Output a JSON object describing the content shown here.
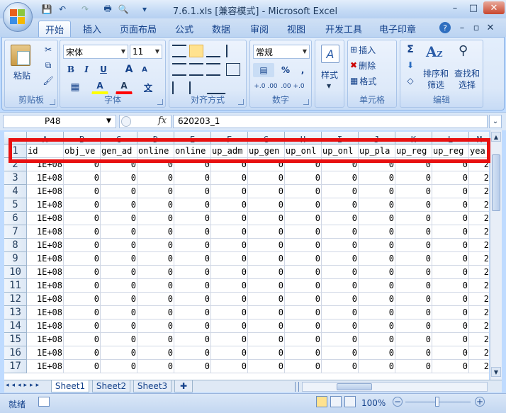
{
  "window": {
    "title": "7.6.1.xls  [兼容模式] - Microsoft Excel",
    "minimize": "–",
    "maximize": "□",
    "close": "✕"
  },
  "qat": {
    "save": "💾",
    "undo": "↶",
    "redo": "↷",
    "print": "🖶",
    "preview": "🔍",
    "more": "▾"
  },
  "ribbon_tabs": [
    "开始",
    "插入",
    "页面布局",
    "公式",
    "数据",
    "审阅",
    "视图",
    "开发工具",
    "电子印章"
  ],
  "ribbon_right": {
    "help": "?",
    "min": "–",
    "restore": "▫",
    "close": "✕"
  },
  "clipboard": {
    "label": "剪贴板",
    "paste": "粘贴",
    "cut": "✂",
    "copy": "⧉",
    "format_painter": "🖌"
  },
  "font": {
    "label": "字体",
    "name": "宋体",
    "size": "11",
    "bold": "B",
    "italic": "I",
    "underline": "U",
    "grow": "A",
    "shrink": "A",
    "border": "▦",
    "fill": "A",
    "color": "A",
    "phonetic": "文",
    "fill_color": "#ffff00",
    "font_color": "#ff0000"
  },
  "alignment": {
    "label": "对齐方式"
  },
  "number": {
    "label": "数字",
    "format": "常规",
    "percent": "%",
    "comma": ",",
    "inc": "+.0 .00",
    "dec": ".00 +.0"
  },
  "styles": {
    "label": "样式"
  },
  "cells": {
    "label": "单元格",
    "insert": "插入",
    "delete": "删除",
    "format": "格式"
  },
  "editing": {
    "label": "编辑",
    "sigma": "Σ",
    "sort": "排序和\n筛选",
    "find": "查找和\n选择",
    "sort1": "排序和",
    "sort2": "筛选",
    "find1": "查找和",
    "find2": "选择"
  },
  "namebox": "P48",
  "fx": "fx",
  "formula": "620203_1",
  "columns": [
    "A",
    "B",
    "C",
    "D",
    "E",
    "F",
    "G",
    "H",
    "I",
    "J",
    "K",
    "L",
    "M"
  ],
  "header_row": [
    "id",
    "obj_ve",
    "gen_ad",
    "online",
    "online",
    "up_adm",
    "up_gen",
    "up_onl",
    "up_onl",
    "up_pla",
    "up_reg",
    "up_reg",
    "yea"
  ],
  "row_id_value": "1E+08",
  "row_numbers": [
    "1",
    "2",
    "3",
    "4",
    "5",
    "6",
    "7",
    "8",
    "9",
    "10",
    "11",
    "12",
    "13",
    "14",
    "15",
    "16",
    "17"
  ],
  "zero": "0",
  "last_col_value": "2",
  "sheets": [
    "Sheet1",
    "Sheet2",
    "Sheet3"
  ],
  "status": {
    "ready": "就绪",
    "zoom": "100%"
  },
  "accent": "#e81010"
}
